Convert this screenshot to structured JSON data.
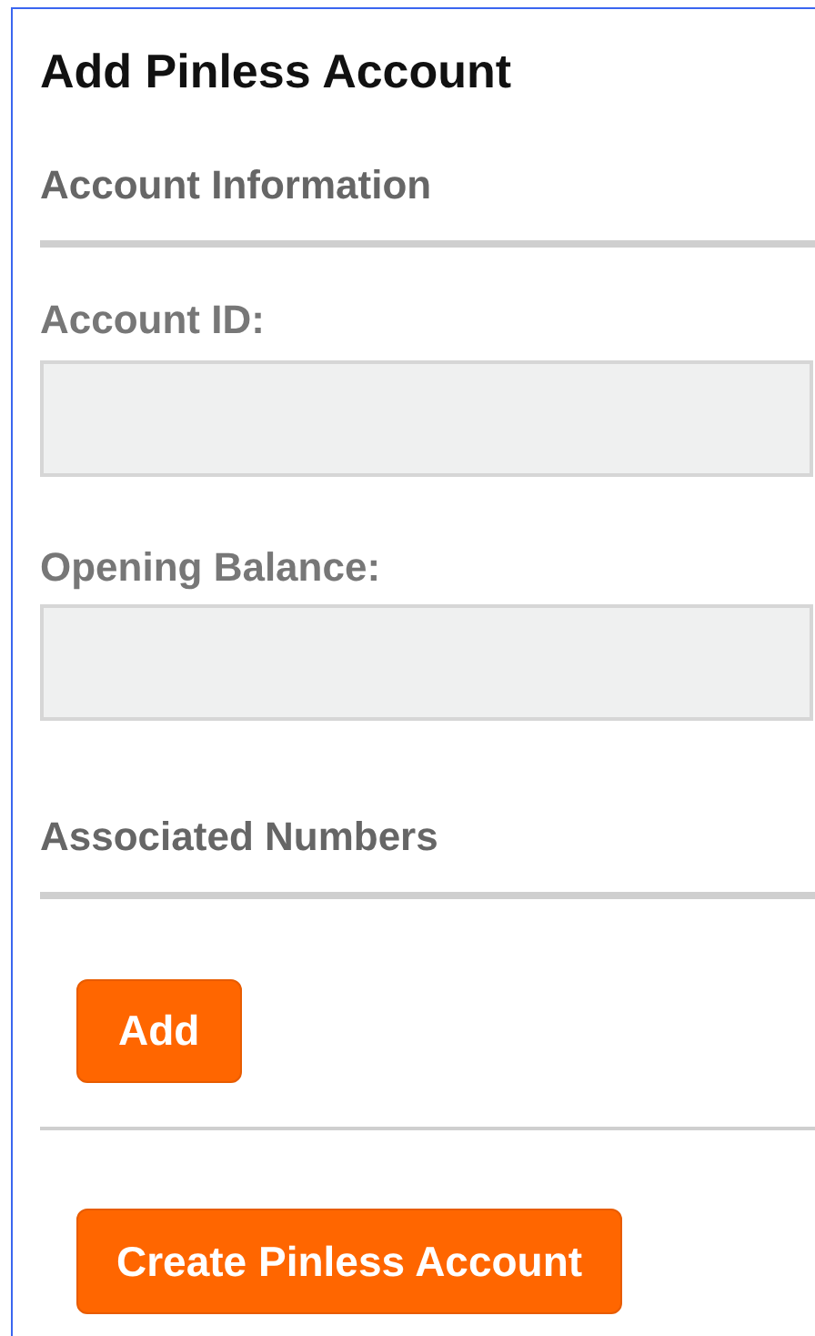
{
  "title": "Add Pinless Account",
  "sections": [
    {
      "heading": "Account Information",
      "fields": [
        {
          "label": "Account ID:"
        },
        {
          "label": "Opening Balance:"
        }
      ]
    },
    {
      "heading": "Associated Numbers",
      "buttons": [
        "Add"
      ]
    }
  ],
  "submit": "Create Pinless Account"
}
